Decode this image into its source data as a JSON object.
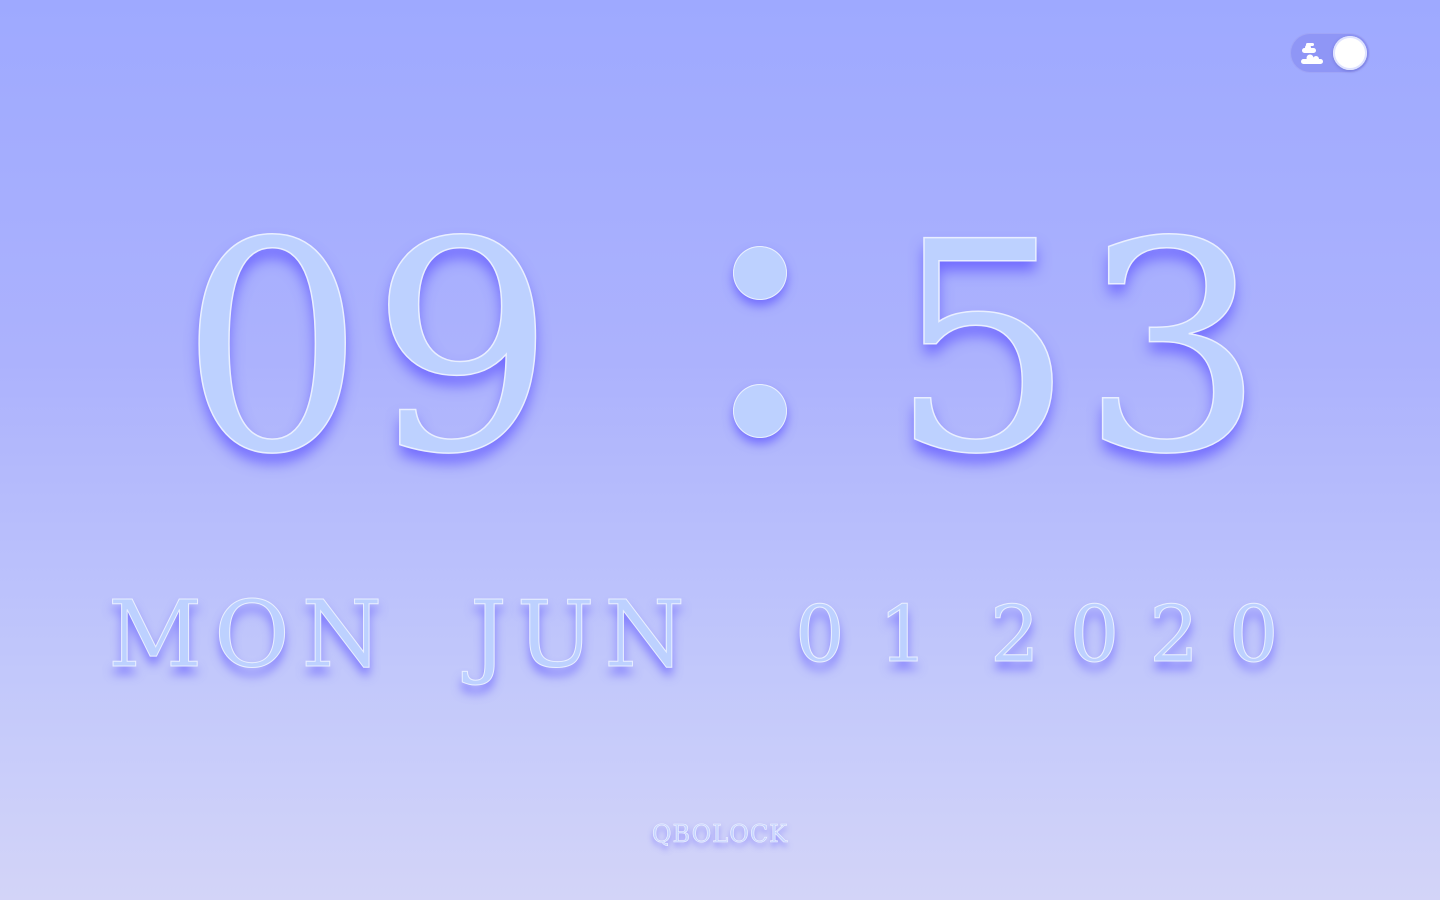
{
  "theme_toggle": {
    "state": "light",
    "icon": "cloud-icon",
    "knob_color": "#ffffff",
    "track_color": "#8f96f6"
  },
  "clock": {
    "hours": "09",
    "separator": ":",
    "minutes": "53"
  },
  "date": {
    "weekday": "MON",
    "month": "JUN",
    "day": "01",
    "year": "2020"
  },
  "logo": {
    "text": "QBOLOCK"
  },
  "colors": {
    "background_top": "#9ea9ff",
    "background_bottom": "#d3d4f8",
    "digit_fill": "#bdd1ff",
    "digit_shadow": "#675eff"
  }
}
